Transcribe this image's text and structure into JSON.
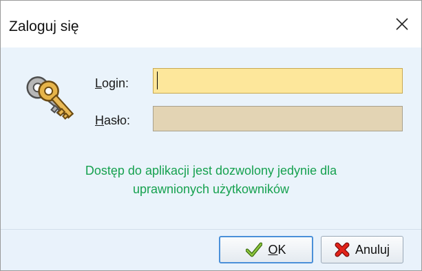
{
  "window": {
    "title": "Zaloguj się",
    "close_icon": "close-icon"
  },
  "form": {
    "login_label_accel": "L",
    "login_label_rest": "ogin:",
    "login_value": "",
    "password_label_accel": "H",
    "password_label_rest": "asło:",
    "password_value": "",
    "icon": "keys-icon"
  },
  "notice": {
    "line1": "Dostęp do aplikacji jest dozwolony jedynie dla",
    "line2": "uprawnionych użytkowników"
  },
  "buttons": {
    "ok_accel": "O",
    "ok_rest": "K",
    "ok_icon": "checkmark-icon",
    "cancel_label": "Anuluj",
    "cancel_icon": "red-x-icon"
  },
  "colors": {
    "login_field_bg": "#fde79b",
    "password_field_bg": "#e3d4b4",
    "notice_text": "#16a14f",
    "client_bg": "#eaf3fb"
  }
}
